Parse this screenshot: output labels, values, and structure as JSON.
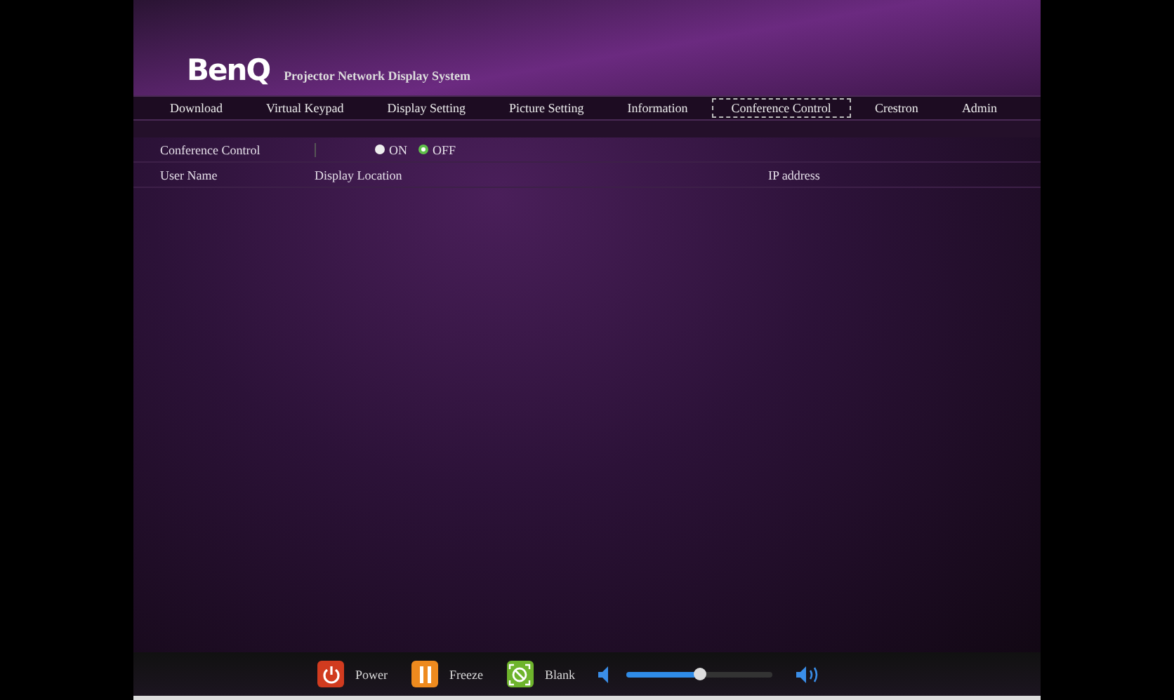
{
  "header": {
    "logo": "BenQ",
    "title": "Projector Network Display System"
  },
  "nav": [
    {
      "label": "Download",
      "selected": false
    },
    {
      "label": "Virtual Keypad",
      "selected": false
    },
    {
      "label": "Display Setting",
      "selected": false
    },
    {
      "label": "Picture Setting",
      "selected": false
    },
    {
      "label": "Information",
      "selected": false
    },
    {
      "label": "Conference Control",
      "selected": true
    },
    {
      "label": "Crestron",
      "selected": false
    },
    {
      "label": "Admin",
      "selected": false
    }
  ],
  "conference": {
    "label": "Conference Control",
    "options": [
      {
        "label": "ON",
        "selected": false
      },
      {
        "label": "OFF",
        "selected": true
      }
    ]
  },
  "table": {
    "columns": [
      "User Name",
      "Display Location",
      "IP address"
    ]
  },
  "controls": [
    {
      "kind": "power",
      "label": "Power"
    },
    {
      "kind": "freeze",
      "label": "Freeze"
    },
    {
      "kind": "blank",
      "label": "Blank"
    }
  ],
  "volume": {
    "level": 0.5
  }
}
